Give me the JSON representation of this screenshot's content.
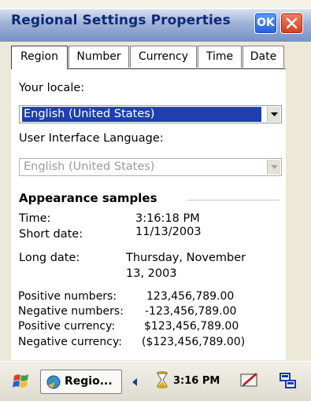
{
  "window": {
    "title": "Regional Settings Properties",
    "ok_label": "OK"
  },
  "tabs": [
    {
      "label": "Region",
      "active": true
    },
    {
      "label": "Number",
      "active": false
    },
    {
      "label": "Currency",
      "active": false
    },
    {
      "label": "Time",
      "active": false
    },
    {
      "label": "Date",
      "active": false
    }
  ],
  "region": {
    "locale_label": "Your locale:",
    "locale_value": "English (United States)",
    "ui_language_label": "User Interface Language:",
    "ui_language_value": "English (United States)"
  },
  "samples": {
    "heading": "Appearance samples",
    "time_label": "Time:",
    "time_value": "3:16:18 PM",
    "short_date_label": "Short date:",
    "short_date_value": "11/13/2003",
    "long_date_label": "Long date:",
    "long_date_value_line1": "Thursday, November",
    "long_date_value_line2": "13, 2003",
    "positive_numbers_label": "Positive numbers:",
    "positive_numbers_value": "123,456,789.00",
    "negative_numbers_label": "Negative numbers:",
    "negative_numbers_value": "-123,456,789.00",
    "positive_currency_label": "Positive currency:",
    "positive_currency_value": "$123,456,789.00",
    "negative_currency_label": "Negative currency:",
    "negative_currency_value": "($123,456,789.00)"
  },
  "taskbar": {
    "task_label": "Regio...",
    "clock": "3:16 PM"
  },
  "icons": {
    "start": "windows-flag-icon",
    "task": "globe-icon",
    "scroll_left": "left-arrow-icon",
    "clock": "hourglass-icon",
    "input": "keyboard-pen-icon",
    "connectivity": "network-icon"
  },
  "colors": {
    "title_text": "#0a2a7a",
    "selection": "#1f3fae",
    "ok_button": "#2860d8",
    "close_button": "#d04020"
  }
}
